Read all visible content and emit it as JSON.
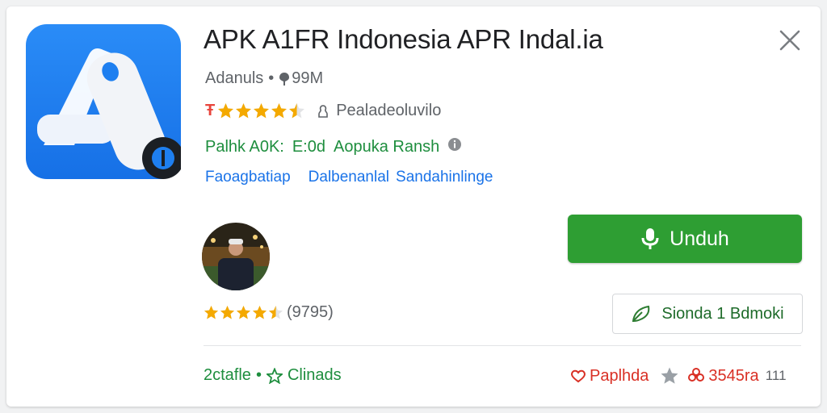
{
  "app": {
    "title": "APK A1FR Indonesia  APR Indal.ia",
    "developer": "Adanuls",
    "separator": "•",
    "size": "99M",
    "rating_prefix": "Ŧ",
    "rating_value_stars": 4.5,
    "rating_label": "Pealadeoluvilo",
    "green_info": [
      "Palhk A0K:",
      "E:0d",
      "Aopuka Ransh"
    ],
    "links": [
      "Faoagbatiap",
      "Dalbenanlal",
      "Sandahinlinge"
    ]
  },
  "reviewer": {
    "stars": 4.5,
    "count": "(9795)"
  },
  "actions": {
    "download_label": "Unduh",
    "secondary_label": "Sionda 1 Bdmoki"
  },
  "footer": {
    "left_label": "2ctafle",
    "left_separator": "•",
    "left_sub": "Clinads",
    "right_label": "Paplhda",
    "right_count": "3545ra",
    "right_num": "111"
  },
  "colors": {
    "accent_green": "#2e9e33",
    "link_blue": "#1a73e8",
    "star_yellow": "#f4a900",
    "icon_blue": "#1e7ff0"
  },
  "icons": [
    "app-logo-icon",
    "close-icon",
    "mic-icon",
    "info-icon",
    "leaf-icon",
    "star-icon",
    "heart-icon",
    "flower-icon"
  ]
}
